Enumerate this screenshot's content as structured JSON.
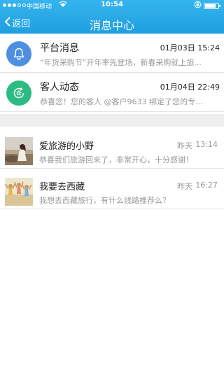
{
  "status_bar": {
    "carrier": "中国移动",
    "time": "10:54",
    "battery_level": 0.85
  },
  "nav": {
    "back_label": "返回",
    "title": "消息中心"
  },
  "system_messages": [
    {
      "title": "平台消息",
      "time": "01月03日 15:24",
      "preview": "“年货采购节”开年率先登场，新春采购就上旅...",
      "icon": "bell-icon",
      "color": "#4d8fe0"
    },
    {
      "title": "客人动态",
      "time": "01月04日 22:49",
      "preview": "恭喜您！您的客人 @客户9633 绑定了您的专...",
      "icon": "star-refresh-icon",
      "color": "#2dbb84"
    }
  ],
  "chats": [
    {
      "name": "爱旅游的小野",
      "day": "昨天",
      "time": "13:14",
      "preview": "恭喜我们旅游回来了，非常开心，十分感谢！",
      "avatar": "beach-girl-avatar"
    },
    {
      "name": "我要去西藏",
      "day": "昨天",
      "time": "16:27",
      "preview": "我想去西藏旅行，有什么线路推荐么？",
      "avatar": "friends-jumping-avatar"
    }
  ],
  "colors": {
    "header": "#1fa0e0",
    "divider": "#e3e3e3",
    "section_gap": "#efefef"
  }
}
